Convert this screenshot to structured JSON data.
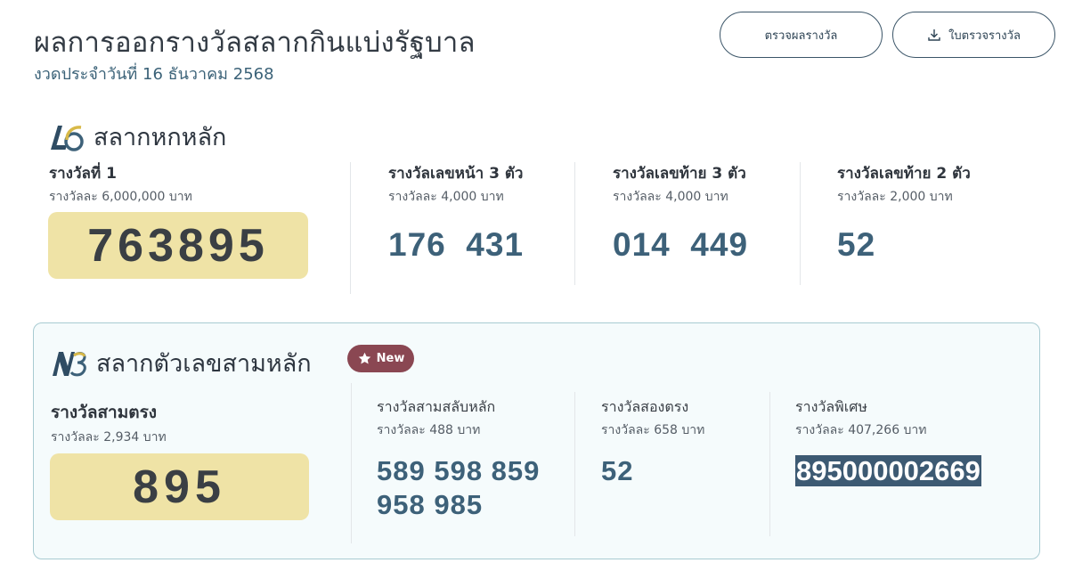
{
  "header": {
    "title": "ผลการออกรางวัลสลากกินแบ่งรัฐบาล",
    "subtitle": "งวดประจำวันที่ 16 ธันวาคม 2568",
    "check_button": "ตรวจผลรางวัล",
    "download_button": "ใบตรวจรางวัล",
    "download_icon": "download-icon"
  },
  "l6": {
    "logo_text": "L6",
    "title": "สลากหกหลัก",
    "prizes": [
      {
        "name": "รางวัลที่ 1",
        "amount": "รางวัลละ 6,000,000 บาท",
        "numbers": "763895"
      },
      {
        "name": "รางวัลเลขหน้า 3 ตัว",
        "amount": "รางวัลละ 4,000 บาท",
        "numbers": "176  431"
      },
      {
        "name": "รางวัลเลขท้าย 3 ตัว",
        "amount": "รางวัลละ 4,000 บาท",
        "numbers": "014  449"
      },
      {
        "name": "รางวัลเลขท้าย 2 ตัว",
        "amount": "รางวัลละ 2,000 บาท",
        "numbers": "52"
      }
    ]
  },
  "n3": {
    "logo_text": "N3",
    "title": "สลากตัวเลขสามหลัก",
    "badge": "New",
    "badge_icon": "star-icon",
    "prizes": [
      {
        "name": "รางวัลสามตรง",
        "amount": "รางวัลละ 2,934 บาท",
        "numbers": "895"
      },
      {
        "name": "รางวัลสามสลับหลัก",
        "amount": "รางวัลละ 488 บาท",
        "numbers_line1": "589 598 859",
        "numbers_line2": "958 985"
      },
      {
        "name": "รางวัลสองตรง",
        "amount": "รางวัลละ 658 บาท",
        "numbers": "52"
      },
      {
        "name": "รางวัลพิเศษ",
        "amount": "รางวัลละ 407,266 บาท",
        "numbers": "895000002669"
      }
    ]
  },
  "colors": {
    "accent": "#3d6179",
    "gold_box": "#efe3a6",
    "badge": "#8a4752",
    "panel_border": "#a8cbd2"
  }
}
